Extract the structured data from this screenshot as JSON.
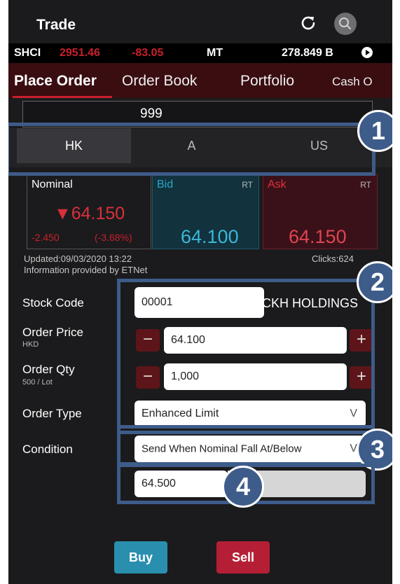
{
  "header": {
    "title": "Trade",
    "refresh_icon": "refresh-icon",
    "search_icon": "search-icon"
  },
  "ticker": {
    "index_name": "SHCI",
    "index_value": "2951.46",
    "index_change": "-83.05",
    "unit": "MT",
    "turnover": "278.849 B",
    "play_icon": "play-icon"
  },
  "tabs": [
    {
      "label": "Place Order",
      "active": true
    },
    {
      "label": "Order Book",
      "active": false
    },
    {
      "label": "Portfolio",
      "active": false
    },
    {
      "label": "Cash O",
      "active": false
    }
  ],
  "stock_input": {
    "value": "999"
  },
  "markets": [
    {
      "label": "HK",
      "active": true
    },
    {
      "label": "A",
      "active": false
    },
    {
      "label": "US",
      "active": false
    }
  ],
  "quote": {
    "nominal_label": "Nominal",
    "nominal_price": "▼64.150",
    "nominal_change": "-2.450",
    "nominal_pct": "(-3.68%)",
    "bid_label": "Bid",
    "bid_rt": "RT",
    "bid_value": "64.100",
    "ask_label": "Ask",
    "ask_rt": "RT",
    "ask_value": "64.150",
    "updated": "Updated:09/03/2020 13:22",
    "provider": "Information provided by ETNet",
    "clicks": "Clicks:624"
  },
  "form": {
    "stock_code_label": "Stock Code",
    "stock_code_value": "00001",
    "stock_name": "CKH HOLDINGS",
    "order_price_label": "Order Price",
    "order_price_currency": "HKD",
    "order_price_value": "64.100",
    "order_qty_label": "Order Qty",
    "order_qty_lot": "500 / Lot",
    "order_qty_value": "1,000",
    "minus": "−",
    "plus": "+",
    "order_type_label": "Order Type",
    "order_type_value": "Enhanced Limit",
    "condition_label": "Condition",
    "condition_value": "Send When Nominal Fall At/Below",
    "trigger_value": "64.500",
    "chevron": "V"
  },
  "actions": {
    "buy": "Buy",
    "sell": "Sell"
  },
  "callouts": [
    "1",
    "2",
    "3",
    "4"
  ],
  "colors": {
    "accent_red": "#c8202c",
    "bid_blue": "#2a8fae",
    "annotation_blue": "#3e5c8a"
  }
}
